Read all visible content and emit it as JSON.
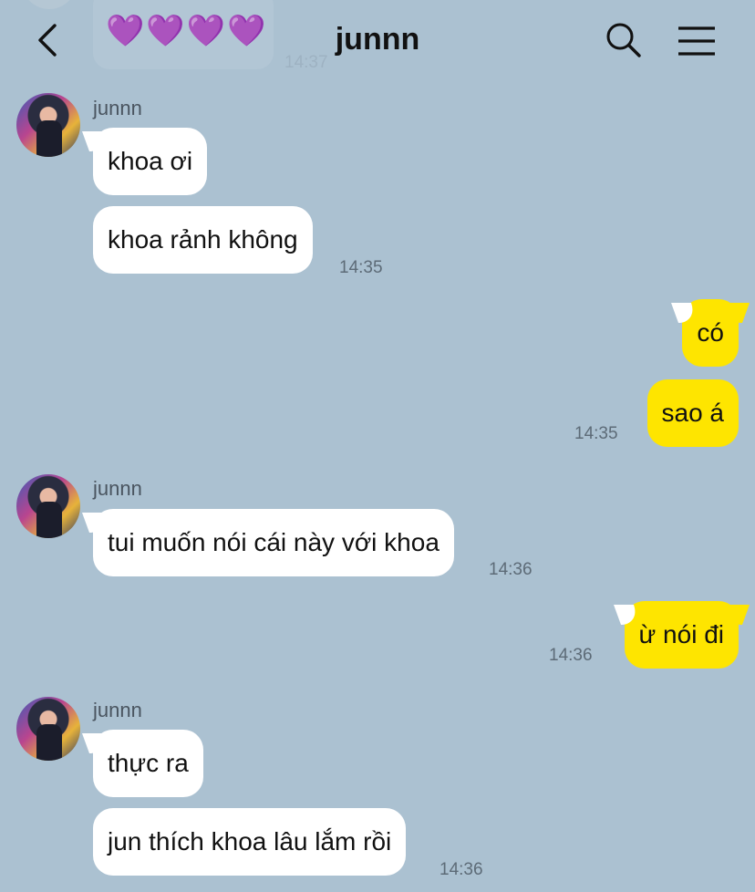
{
  "header": {
    "title": "junnn",
    "back_icon": "chevron-left-icon",
    "search_icon": "search-icon",
    "menu_icon": "hamburger-menu-icon"
  },
  "faded_previous": {
    "content": "💜💜💜💜",
    "time": "14:37"
  },
  "messages": {
    "g1": {
      "sender": "junnn",
      "m1": "khoa ơi",
      "m2": "khoa rảnh không",
      "time": "14:35"
    },
    "g2": {
      "m1": "có",
      "m2": "sao á",
      "time": "14:35"
    },
    "g3": {
      "sender": "junnn",
      "m1": "tui muốn nói cái này với khoa",
      "time": "14:36"
    },
    "g4": {
      "m1": "ừ nói đi",
      "time": "14:36"
    },
    "g5": {
      "sender": "junnn",
      "m1": "thực ra",
      "m2": "jun thích khoa lâu lắm rồi",
      "time": "14:36"
    }
  },
  "colors": {
    "background": "#abc1d1",
    "my_bubble": "#fee500",
    "their_bubble": "#ffffff"
  }
}
